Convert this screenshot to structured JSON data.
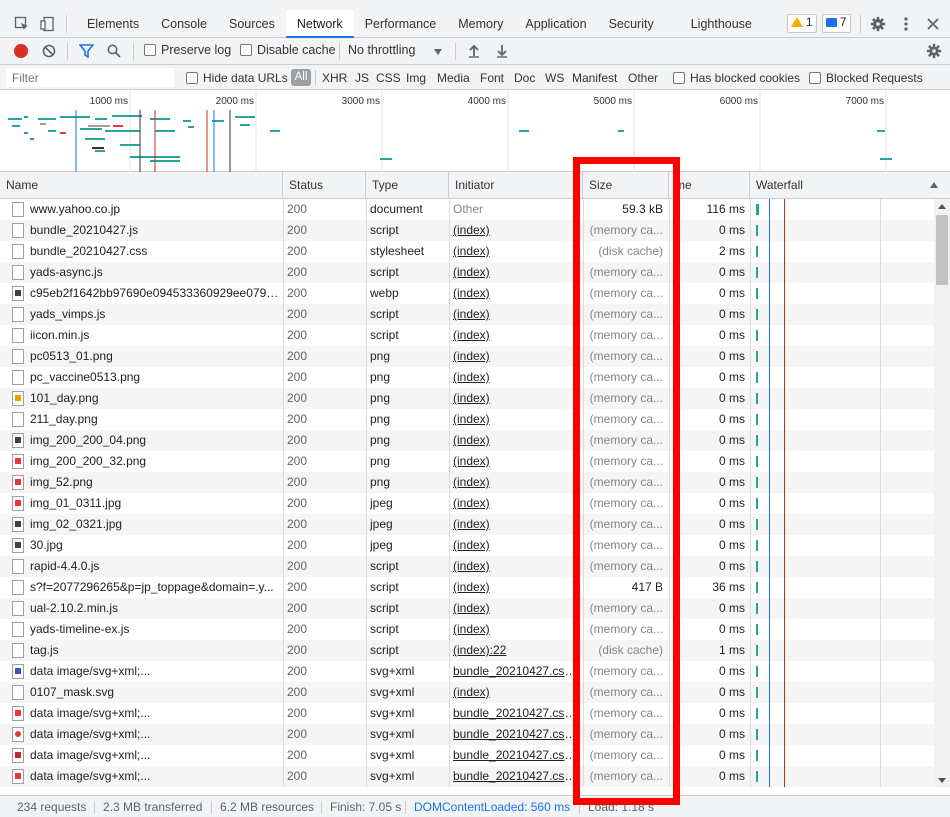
{
  "tabbar": {
    "tabs": [
      "Elements",
      "Console",
      "Sources",
      "Network",
      "Performance",
      "Memory",
      "Application",
      "Security",
      "Lighthouse"
    ],
    "active": "Network",
    "warnings": "1",
    "messages": "7"
  },
  "toolbar": {
    "preserve_log": "Preserve log",
    "disable_cache": "Disable cache",
    "throttling": "No throttling"
  },
  "filterbar": {
    "placeholder": "Filter",
    "hide_data_urls": "Hide data URLs",
    "all": "All",
    "types": [
      "XHR",
      "JS",
      "CSS",
      "Img",
      "Media",
      "Font",
      "Doc",
      "WS",
      "Manifest",
      "Other"
    ],
    "has_blocked_cookies": "Has blocked cookies",
    "blocked_requests": "Blocked Requests"
  },
  "overview": {
    "ticks": [
      "1000 ms",
      "2000 ms",
      "3000 ms",
      "4000 ms",
      "5000 ms",
      "6000 ms",
      "7000 ms"
    ]
  },
  "table": {
    "headers": {
      "name": "Name",
      "status": "Status",
      "type": "Type",
      "initiator": "Initiator",
      "size": "Size",
      "time": "me",
      "waterfall": "Waterfall"
    },
    "rows": [
      {
        "name": "www.yahoo.co.jp",
        "status": "200",
        "type": "document",
        "initiator": "Other",
        "size": "59.3 kB",
        "time": "116 ms",
        "icon": "doc"
      },
      {
        "name": "bundle_20210427.js",
        "status": "200",
        "type": "script",
        "initiator": "(index)",
        "size": "(memory ca...",
        "time": "0 ms",
        "icon": "doc"
      },
      {
        "name": "bundle_20210427.css",
        "status": "200",
        "type": "stylesheet",
        "initiator": "(index)",
        "size": "(disk cache)",
        "time": "2 ms",
        "icon": "doc"
      },
      {
        "name": "yads-async.js",
        "status": "200",
        "type": "script",
        "initiator": "(index)",
        "size": "(memory ca...",
        "time": "0 ms",
        "icon": "doc"
      },
      {
        "name": "c95eb2f1642bb97690e094533360929ee0791...",
        "status": "200",
        "type": "webp",
        "initiator": "(index)",
        "size": "(memory ca...",
        "time": "0 ms",
        "icon": "img-dark"
      },
      {
        "name": "yads_vimps.js",
        "status": "200",
        "type": "script",
        "initiator": "(index)",
        "size": "(memory ca...",
        "time": "0 ms",
        "icon": "doc"
      },
      {
        "name": "iicon.min.js",
        "status": "200",
        "type": "script",
        "initiator": "(index)",
        "size": "(memory ca...",
        "time": "0 ms",
        "icon": "doc"
      },
      {
        "name": "pc0513_01.png",
        "status": "200",
        "type": "png",
        "initiator": "(index)",
        "size": "(memory ca...",
        "time": "0 ms",
        "icon": "doc"
      },
      {
        "name": "pc_vaccine0513.png",
        "status": "200",
        "type": "png",
        "initiator": "(index)",
        "size": "(memory ca...",
        "time": "0 ms",
        "icon": "doc"
      },
      {
        "name": "101_day.png",
        "status": "200",
        "type": "png",
        "initiator": "(index)",
        "size": "(memory ca...",
        "time": "0 ms",
        "icon": "img-orange"
      },
      {
        "name": "211_day.png",
        "status": "200",
        "type": "png",
        "initiator": "(index)",
        "size": "(memory ca...",
        "time": "0 ms",
        "icon": "doc"
      },
      {
        "name": "img_200_200_04.png",
        "status": "200",
        "type": "png",
        "initiator": "(index)",
        "size": "(memory ca...",
        "time": "0 ms",
        "icon": "img-dark"
      },
      {
        "name": "img_200_200_32.png",
        "status": "200",
        "type": "png",
        "initiator": "(index)",
        "size": "(memory ca...",
        "time": "0 ms",
        "icon": "img-red"
      },
      {
        "name": "img_52.png",
        "status": "200",
        "type": "png",
        "initiator": "(index)",
        "size": "(memory ca...",
        "time": "0 ms",
        "icon": "img-red"
      },
      {
        "name": "img_01_0311.jpg",
        "status": "200",
        "type": "jpeg",
        "initiator": "(index)",
        "size": "(memory ca...",
        "time": "0 ms",
        "icon": "img-red"
      },
      {
        "name": "img_02_0321.jpg",
        "status": "200",
        "type": "jpeg",
        "initiator": "(index)",
        "size": "(memory ca...",
        "time": "0 ms",
        "icon": "img-dark"
      },
      {
        "name": "30.jpg",
        "status": "200",
        "type": "jpeg",
        "initiator": "(index)",
        "size": "(memory ca...",
        "time": "0 ms",
        "icon": "img-dark"
      },
      {
        "name": "rapid-4.4.0.js",
        "status": "200",
        "type": "script",
        "initiator": "(index)",
        "size": "(memory ca...",
        "time": "0 ms",
        "icon": "doc"
      },
      {
        "name": "s?f=2077296265&p=jp_toppage&domain=.y...",
        "status": "200",
        "type": "script",
        "initiator": "(index)",
        "size": "417 B",
        "time": "36 ms",
        "icon": "doc"
      },
      {
        "name": "ual-2.10.2.min.js",
        "status": "200",
        "type": "script",
        "initiator": "(index)",
        "size": "(memory ca...",
        "time": "0 ms",
        "icon": "doc"
      },
      {
        "name": "yads-timeline-ex.js",
        "status": "200",
        "type": "script",
        "initiator": "(index)",
        "size": "(memory ca...",
        "time": "0 ms",
        "icon": "doc"
      },
      {
        "name": "tag.js",
        "status": "200",
        "type": "script",
        "initiator": "(index):22",
        "size": "(disk cache)",
        "time": "1 ms",
        "icon": "doc"
      },
      {
        "name": "data image/svg+xml;...",
        "status": "200",
        "type": "svg+xml",
        "initiator": "bundle_20210427.css:...",
        "size": "(memory ca...",
        "time": "0 ms",
        "icon": "img-blue"
      },
      {
        "name": "0107_mask.svg",
        "status": "200",
        "type": "svg+xml",
        "initiator": "(index)",
        "size": "(memory ca...",
        "time": "0 ms",
        "icon": "doc"
      },
      {
        "name": "data image/svg+xml;...",
        "status": "200",
        "type": "svg+xml",
        "initiator": "bundle_20210427.css:...",
        "size": "(memory ca...",
        "time": "0 ms",
        "icon": "img-red"
      },
      {
        "name": "data image/svg+xml;...",
        "status": "200",
        "type": "svg+xml",
        "initiator": "bundle_20210427.css:...",
        "size": "(memory ca...",
        "time": "0 ms",
        "icon": "img-redcircle"
      },
      {
        "name": "data image/svg+xml;...",
        "status": "200",
        "type": "svg+xml",
        "initiator": "bundle_20210427.css:...",
        "size": "(memory ca...",
        "time": "0 ms",
        "icon": "img-redbox"
      },
      {
        "name": "data image/svg+xml;...",
        "status": "200",
        "type": "svg+xml",
        "initiator": "bundle_20210427.css:...",
        "size": "(memory ca...",
        "time": "0 ms",
        "icon": "img-red"
      }
    ]
  },
  "statusbar": {
    "requests": "234 requests",
    "transferred": "2.3 MB transferred",
    "resources": "6.2 MB resources",
    "finish": "Finish: 7.05 s",
    "dom_content_loaded": "DOMContentLoaded: 560 ms",
    "load": "Load: 1.18 s"
  },
  "colors": {
    "accent": "#1a73e8",
    "record": "#d93025",
    "highlight": "#ff0000",
    "waterfall_bar": "#26a69a",
    "dcl_line": "#1a73e8",
    "load_line": "#c62828"
  }
}
